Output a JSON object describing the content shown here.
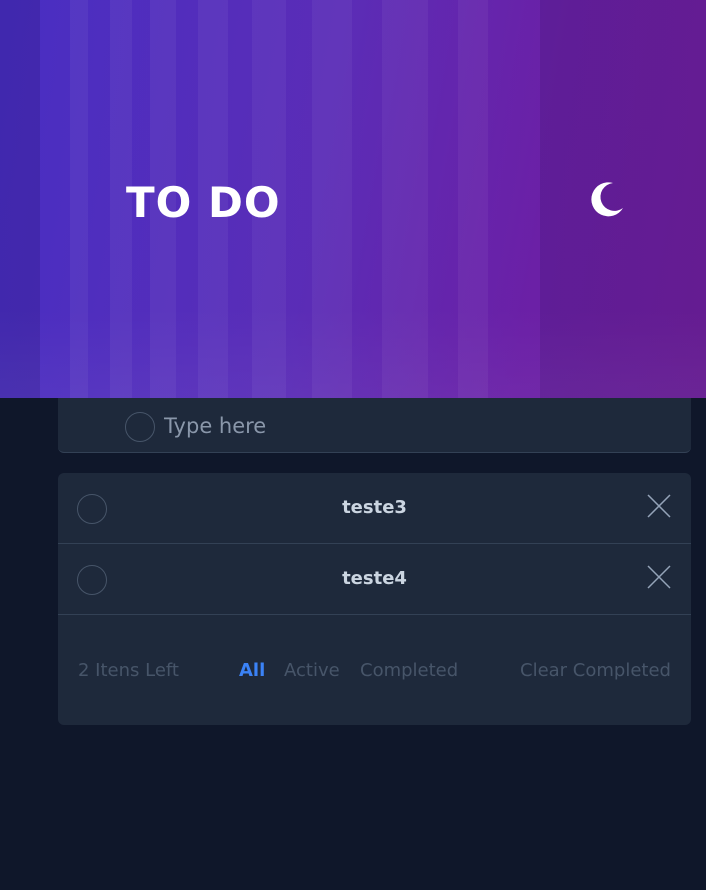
{
  "header": {
    "title": "TO DO",
    "theme_icon": "moon-icon"
  },
  "new_todo": {
    "placeholder": "Type here",
    "value": ""
  },
  "todos": [
    {
      "text": "teste3",
      "completed": false
    },
    {
      "text": "teste4",
      "completed": false
    }
  ],
  "footer": {
    "items_left": "2 Itens Left",
    "filters": [
      "All",
      "Active",
      "Completed"
    ],
    "selected_filter": "All",
    "clear_completed": "Clear Completed"
  },
  "colors": {
    "background": "#0f172a",
    "card": "#1e293b",
    "accent": "#3b82f6",
    "muted_text": "#475569",
    "item_text": "#cbd5e1",
    "hero_start": "#4b2fc2",
    "hero_end": "#6f1f9e"
  }
}
